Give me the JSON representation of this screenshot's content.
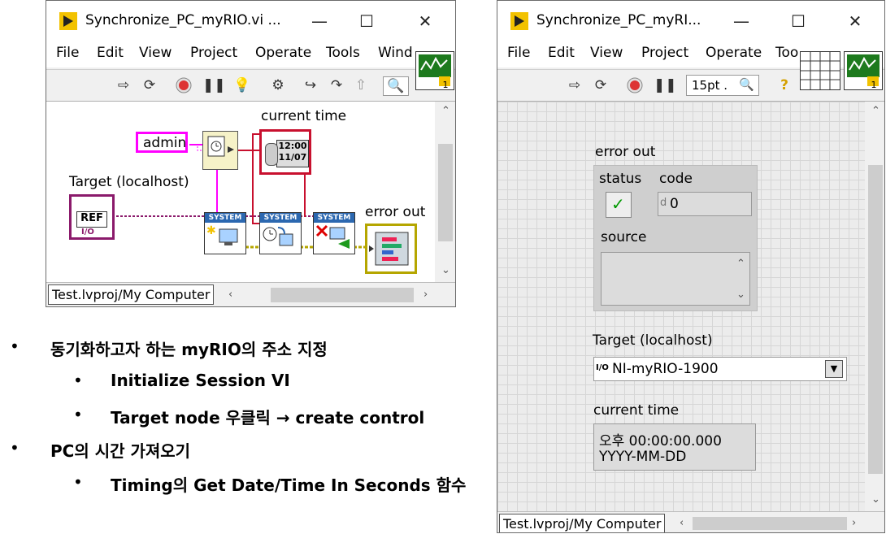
{
  "left_window": {
    "title": "Synchronize_PC_myRIO.vi ...",
    "menu": [
      "File",
      "Edit",
      "View",
      "Project",
      "Operate",
      "Tools",
      "Wind"
    ],
    "diagram": {
      "admin_const": "admin",
      "target_label": "Target (localhost)",
      "ref_label": "REF",
      "io_label": "I/O",
      "current_time_label": "current time",
      "clock_time": "12:00",
      "clock_date": "11/07",
      "error_out_label": "error out",
      "system_label": "SYSTEM"
    },
    "project_path": "Test.lvproj/My Computer"
  },
  "right_window": {
    "title": "Synchronize_PC_myRI...",
    "menu": [
      "File",
      "Edit",
      "View",
      "Project",
      "Operate",
      "Too"
    ],
    "font_size_label": "15pt .",
    "error_cluster": {
      "label": "error out",
      "status_label": "status",
      "code_label": "code",
      "code_prefix": "d",
      "code_value": "0",
      "source_label": "source"
    },
    "target": {
      "label": "Target (localhost)",
      "io_glyph": "I/O",
      "value": "NI-myRIO-1900"
    },
    "current_time": {
      "label": "current time",
      "line1": "오후 00:00:00.000",
      "line2": "YYYY-MM-DD"
    },
    "project_path": "Test.lvproj/My Computer"
  },
  "bullets": [
    {
      "level": 1,
      "text": "동기화하고자 하는 myRIO의 주소 지정"
    },
    {
      "level": 2,
      "text": "Initialize Session VI"
    },
    {
      "level": 2,
      "text": "Target node 우클릭 → create control"
    },
    {
      "level": 1,
      "text": "PC의 시간 가져오기"
    },
    {
      "level": 2,
      "text": "Timing의 Get Date/Time In Seconds 함수"
    }
  ],
  "bullet_glyph": "•",
  "colors": {
    "string_wire": "#ff00ff",
    "error_wire": "#b5a600",
    "refnum_wire": "#8b1a6b",
    "timestamp_wire": "#c8102e",
    "status_check": "#009900",
    "system_header": "#2c68b0"
  }
}
